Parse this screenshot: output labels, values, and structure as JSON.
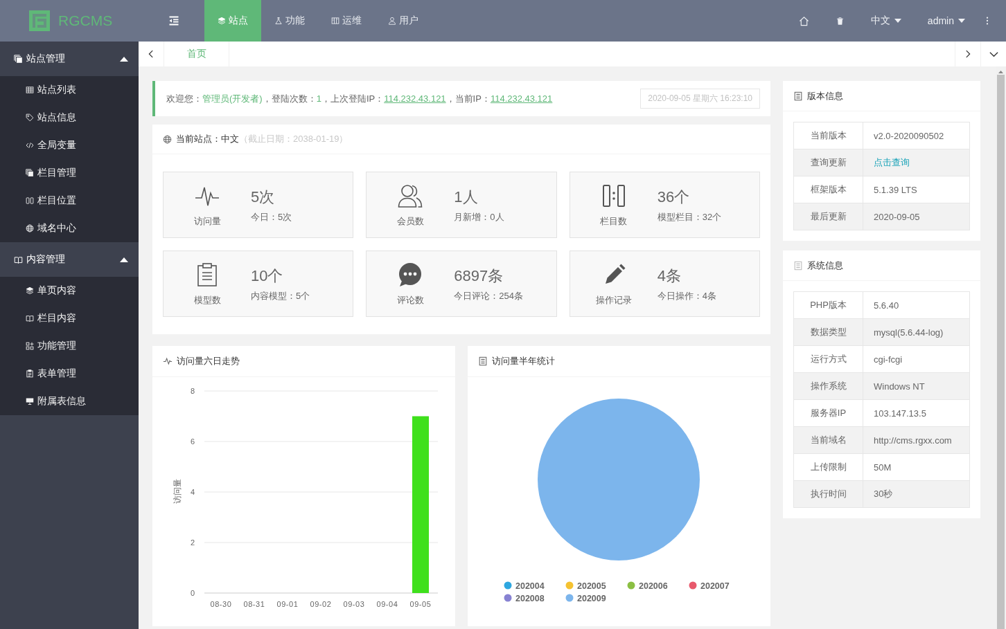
{
  "header": {
    "logo_text": "RGCMS",
    "nav_tabs": [
      {
        "label": "站点",
        "selected": true
      },
      {
        "label": "功能",
        "selected": false
      },
      {
        "label": "运维",
        "selected": false
      },
      {
        "label": "用户",
        "selected": false
      }
    ],
    "language": "中文",
    "user": "admin"
  },
  "sidebar": {
    "groups": [
      {
        "title": "站点管理",
        "expanded": true,
        "items": [
          {
            "label": "站点列表",
            "selected": false
          },
          {
            "label": "站点信息",
            "selected": false
          },
          {
            "label": "全局变量",
            "selected": false
          },
          {
            "label": "栏目管理",
            "selected": false
          },
          {
            "label": "栏目位置",
            "selected": false
          },
          {
            "label": "域名中心",
            "selected": false
          }
        ]
      },
      {
        "title": "内容管理",
        "expanded": true,
        "items": [
          {
            "label": "单页内容",
            "selected": false
          },
          {
            "label": "栏目内容",
            "selected": false
          },
          {
            "label": "功能管理",
            "selected": false
          },
          {
            "label": "表单管理",
            "selected": false
          },
          {
            "label": "附属表信息",
            "selected": false
          }
        ]
      }
    ]
  },
  "page_tabs": [
    {
      "label": "首页",
      "selected": true
    }
  ],
  "welcome": {
    "parts": [
      {
        "kind": "text",
        "text": "欢迎您："
      },
      {
        "kind": "highlight",
        "text": "管理员(开发者)"
      },
      {
        "kind": "text",
        "text": "，登陆次数："
      },
      {
        "kind": "highlight",
        "text": "1"
      },
      {
        "kind": "text",
        "text": "，上次登陆IP："
      },
      {
        "kind": "link",
        "text": "114.232.43.121"
      },
      {
        "kind": "text",
        "text": "，当前IP："
      },
      {
        "kind": "link",
        "text": "114.232.43.121"
      }
    ],
    "datetime": "2020-09-05 星期六 16:23:10"
  },
  "site": {
    "title": "当前站点：中文",
    "expiry": "（截止日期：2038-01-19）",
    "stats": [
      {
        "label": "访问量",
        "value": "5次",
        "detail": "今日：5次"
      },
      {
        "label": "会员数",
        "value": "1人",
        "detail": "月新增：0人"
      },
      {
        "label": "栏目数",
        "value": "36个",
        "detail": "模型栏目：32个"
      },
      {
        "label": "模型数",
        "value": "10个",
        "detail": "内容模型：5个"
      },
      {
        "label": "评论数",
        "value": "6897条",
        "detail": "今日评论：254条"
      },
      {
        "label": "操作记录",
        "value": "4条",
        "detail": "今日操作：4条"
      }
    ]
  },
  "charts": [
    {
      "chart_data": {
        "type": "bar",
        "title": "访问量六日走势",
        "ylabel": "访问量",
        "categories": [
          "08-30",
          "08-31",
          "09-01",
          "09-02",
          "09-03",
          "09-04",
          "09-05"
        ],
        "series": [
          {
            "color": "#3fe01c",
            "values": [
              0,
              0,
              0,
              0,
              0,
              0,
              7
            ]
          }
        ],
        "ylim": [
          0,
          8
        ],
        "yticks": [
          0,
          2,
          4,
          6,
          8
        ],
        "grid": true
      }
    },
    {
      "chart_data": {
        "type": "pie",
        "title": "访问量半年统计",
        "categories": [
          "202004",
          "202005",
          "202006",
          "202007",
          "202008",
          "202009"
        ],
        "values": [
          0,
          0,
          0,
          0,
          0,
          100
        ],
        "colors": [
          "#2ea7e0",
          "#f5c231",
          "#8bbf43",
          "#e8596c",
          "#8782d2",
          "#7cb5ec"
        ]
      }
    }
  ],
  "version_info": {
    "title": "版本信息",
    "rows": [
      {
        "label": "当前版本",
        "value": "v2.0-2020090502",
        "kind": "text"
      },
      {
        "label": "查询更新",
        "value": "点击查询",
        "kind": "link"
      },
      {
        "label": "框架版本",
        "value": "5.1.39 LTS",
        "kind": "text"
      },
      {
        "label": "最后更新",
        "value": "2020-09-05",
        "kind": "text"
      }
    ]
  },
  "system_info": {
    "title": "系统信息",
    "rows": [
      {
        "label": "PHP版本",
        "value": "5.6.40",
        "kind": "text"
      },
      {
        "label": "数据类型",
        "value": "mysql(5.6.44-log)",
        "kind": "text"
      },
      {
        "label": "运行方式",
        "value": "cgi-fcgi",
        "kind": "text"
      },
      {
        "label": "操作系统",
        "value": "Windows NT",
        "kind": "text"
      },
      {
        "label": "服务器IP",
        "value": "103.147.13.5",
        "kind": "text"
      },
      {
        "label": "当前域名",
        "value": "http://cms.rgxx.com",
        "kind": "text"
      },
      {
        "label": "上传限制",
        "value": "50M",
        "kind": "text"
      },
      {
        "label": "执行时间",
        "value": "30秒",
        "kind": "text"
      }
    ]
  }
}
